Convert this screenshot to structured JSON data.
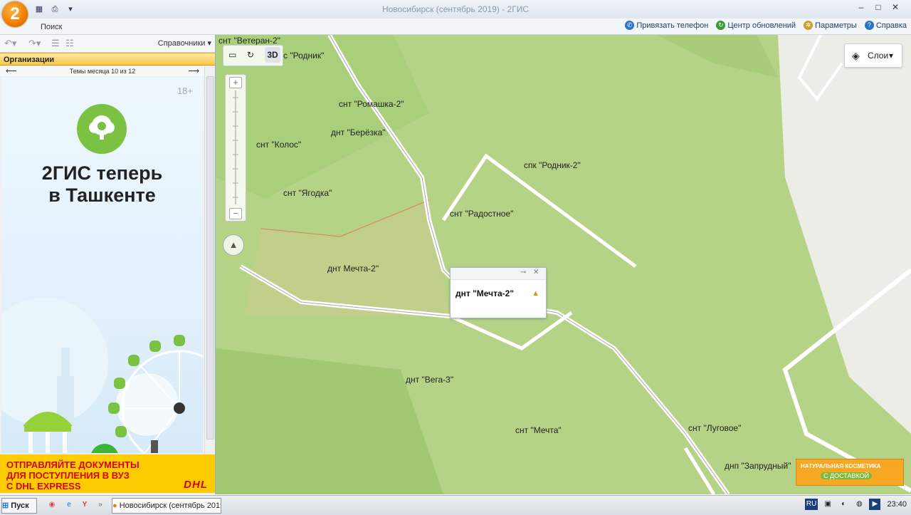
{
  "window": {
    "title": "Новосибирск (сентябрь 2019) - 2ГИС",
    "logo": "2",
    "controls": [
      "–",
      "□",
      "✕"
    ]
  },
  "ribbon": {
    "search_tab": "Поиск",
    "links": [
      {
        "label": "Привязать телефон",
        "icon": "phone-icon",
        "color": "#2a73c5"
      },
      {
        "label": "Центр обновлений",
        "icon": "refresh-icon",
        "color": "#3a9a3a"
      },
      {
        "label": "Параметры",
        "icon": "gear-icon",
        "color": "#c8a12a"
      },
      {
        "label": "Справка",
        "icon": "help-icon",
        "color": "#2a73c5"
      }
    ]
  },
  "left_panel": {
    "directories": "Справочники",
    "section": "Организации",
    "themes": "Темы месяца 10 из 12",
    "ad": {
      "age": "18+",
      "headline_1": "2ГИС теперь",
      "headline_2": "в Ташкенте"
    },
    "dhl": {
      "line1": "ОТПРАВЛЯЙТЕ ДОКУМЕНТЫ",
      "line2": "ДЛЯ ПОСТУПЛЕНИЯ В ВУЗ",
      "line3": "С DHL EXPRESS",
      "logo": "DHL"
    }
  },
  "map": {
    "tools": {
      "three_d": "3D"
    },
    "layers_label": "Слои",
    "labels": [
      "снт \"Ветеран-2\"",
      "с \"Родник\"",
      "снт \"Ромашка-2\"",
      "днт \"Берёзка\"",
      "снт \"Колос\"",
      "спк \"Родник-2\"",
      "снт \"Ягодка\"",
      "снт \"Радостное\"",
      "днт Мечта-2\"",
      "днт \"Вега-3\"",
      "снт \"Мечта\"",
      "снт \"Луговое\"",
      "днп \"Запрудный\""
    ],
    "popup": {
      "title": "днт \"Мечта-2\""
    },
    "cosmetics_ad": {
      "line1": "НАТУРАЛЬНАЯ КОСМЕТИКА",
      "line2": "С ДОСТАВКОЙ"
    }
  },
  "taskbar": {
    "start": "Пуск",
    "app": "Новосибирск (сентябрь 2019) - 2ГИС",
    "lang": "RU",
    "clock": "23:40"
  }
}
